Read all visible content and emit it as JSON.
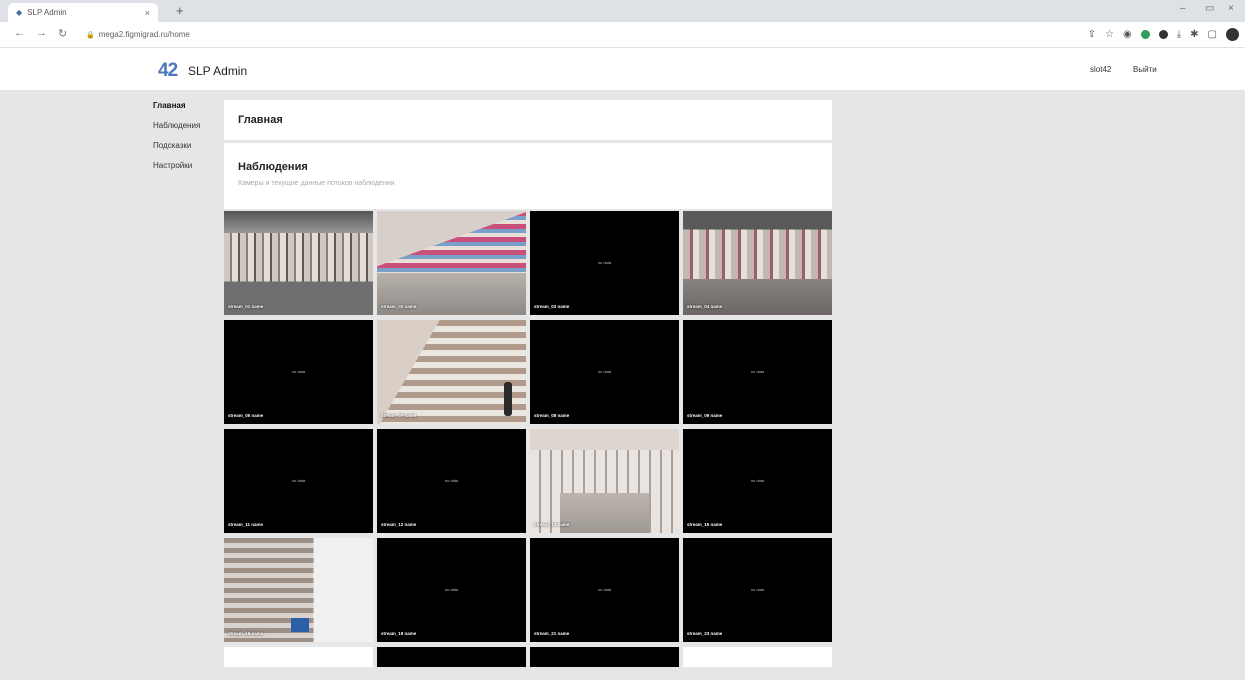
{
  "browser": {
    "tab_title": "SLP Admin",
    "url": "mega2.figmigrad.ru/home"
  },
  "header": {
    "logo": "42",
    "title": "SLP Admin",
    "user": "slot42",
    "logout": "Выйти"
  },
  "sidebar": {
    "items": [
      {
        "label": "Главная"
      },
      {
        "label": "Наблюдения"
      },
      {
        "label": "Подсказки"
      },
      {
        "label": "Настройки"
      }
    ]
  },
  "main": {
    "home_title": "Главная",
    "obs_title": "Наблюдения",
    "obs_subtitle": "Камеры и текущие данные потоков наблюдения"
  },
  "no_signal_text": "no data",
  "streams": [
    {
      "label": "stream_01 name",
      "feed": "camera"
    },
    {
      "label": "stream_02 name",
      "feed": "camera"
    },
    {
      "label": "stream_03 name",
      "feed": "none"
    },
    {
      "label": "stream_04 name",
      "feed": "camera"
    },
    {
      "label": "stream_05 name",
      "feed": "none"
    },
    {
      "label": "stream_07 name",
      "feed": "camera"
    },
    {
      "label": "stream_08 name",
      "feed": "none"
    },
    {
      "label": "stream_09 name",
      "feed": "none"
    },
    {
      "label": "stream_11 name",
      "feed": "none"
    },
    {
      "label": "stream_12 name",
      "feed": "none"
    },
    {
      "label": "stream_13 name",
      "feed": "camera"
    },
    {
      "label": "stream_15 name",
      "feed": "none"
    },
    {
      "label": "stream_16 name",
      "feed": "camera"
    },
    {
      "label": "stream_19 name",
      "feed": "none"
    },
    {
      "label": "stream_21 name",
      "feed": "none"
    },
    {
      "label": "stream_23 name",
      "feed": "none"
    }
  ]
}
